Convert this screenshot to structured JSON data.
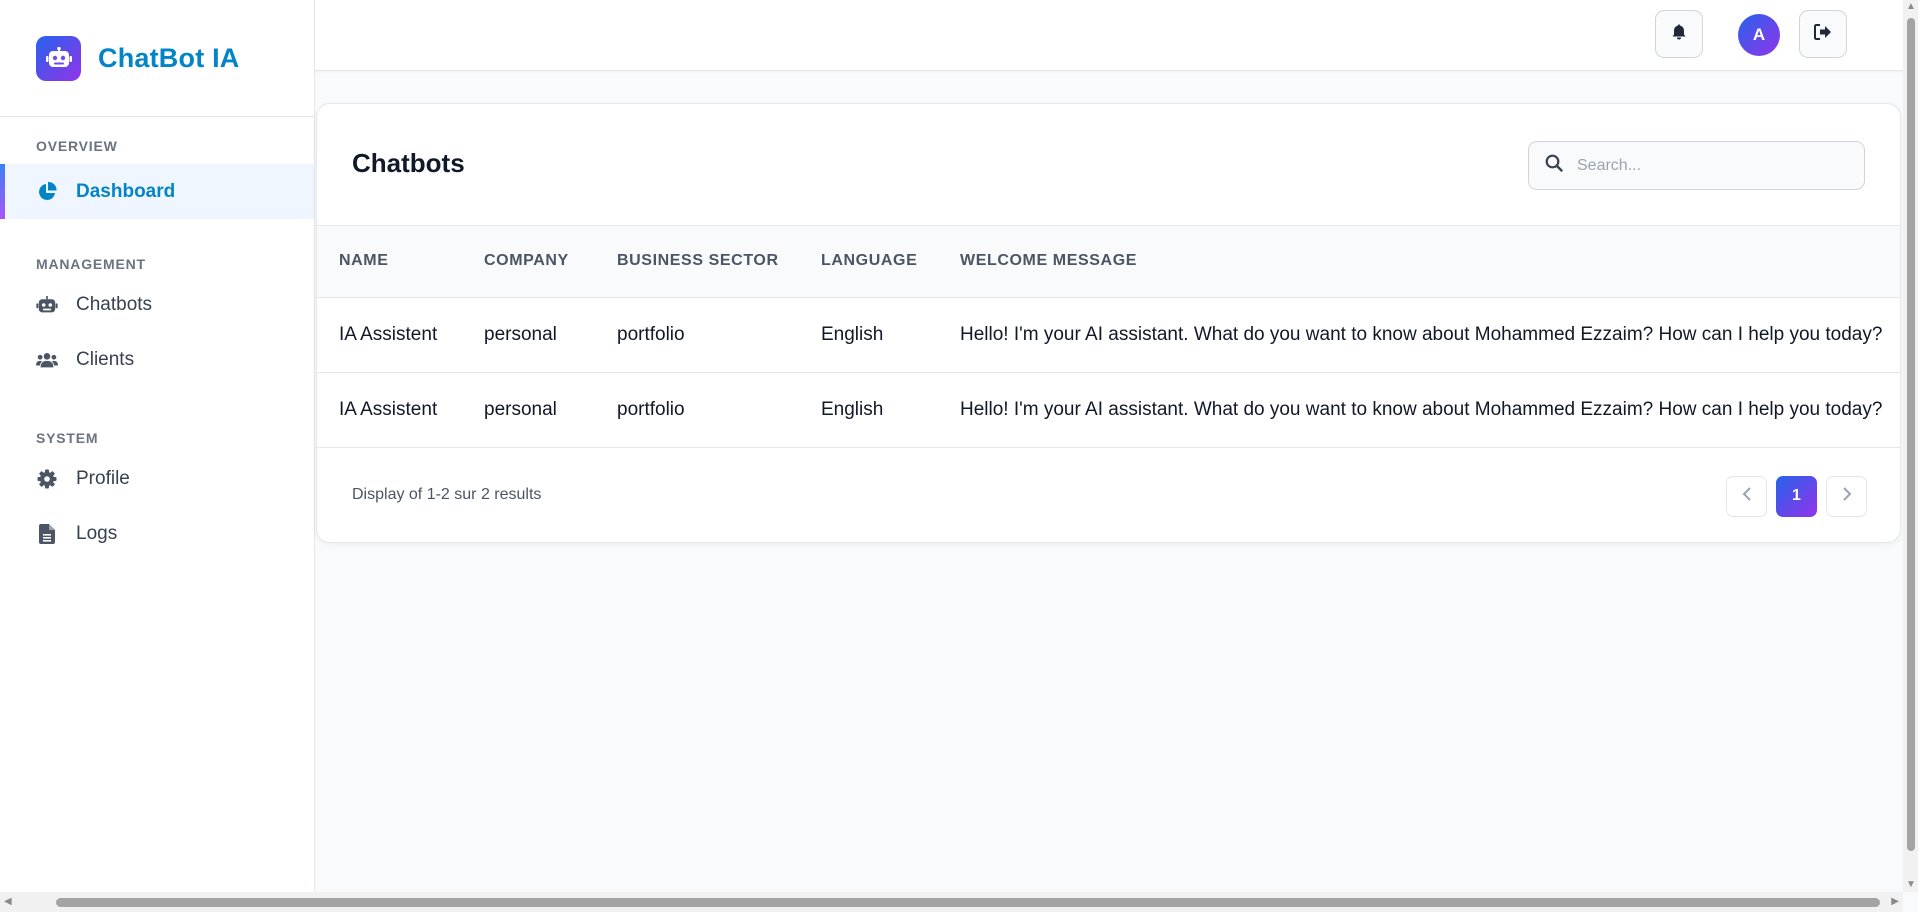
{
  "brand": {
    "name": "ChatBot IA",
    "icon": "robot-icon",
    "accent": "#0284c7"
  },
  "sidebar": {
    "sections": [
      {
        "title": "OVERVIEW"
      },
      {
        "title": "MANAGEMENT"
      },
      {
        "title": "SYSTEM"
      }
    ],
    "items": [
      {
        "label": "Dashboard",
        "icon": "chart-pie-icon",
        "active": true
      },
      {
        "label": "Chatbots",
        "icon": "robot-icon"
      },
      {
        "label": "Clients",
        "icon": "users-icon"
      },
      {
        "label": "Profile",
        "icon": "gear-icon"
      },
      {
        "label": "Logs",
        "icon": "file-icon"
      }
    ]
  },
  "header": {
    "notification_icon": "bell-icon",
    "avatar_initial": "A",
    "logout_icon": "sign-out-icon"
  },
  "main": {
    "title": "Chatbots",
    "search": {
      "placeholder": "Search...",
      "value": ""
    },
    "table": {
      "columns": [
        "NAME",
        "COMPANY",
        "BUSINESS SECTOR",
        "LANGUAGE",
        "WELCOME MESSAGE"
      ],
      "rows": [
        [
          "IA Assistent",
          "personal",
          "portfolio",
          "English",
          "Hello! I'm your AI assistant. What do you want to know about Mohammed Ezzaim? How can I help you today?"
        ],
        [
          "IA Assistent",
          "personal",
          "portfolio",
          "English",
          "Hello! I'm your AI assistant. What do you want to know about Mohammed Ezzaim? How can I help you today?"
        ]
      ]
    },
    "pagination": {
      "summary": "Display of 1-2 sur 2 results",
      "current_page": "1",
      "prev_icon": "chevron-left-icon",
      "next_icon": "chevron-right-icon"
    }
  }
}
